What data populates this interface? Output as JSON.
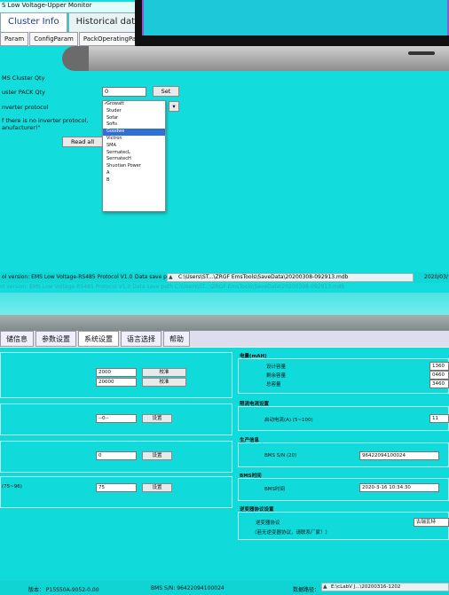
{
  "top": {
    "title": "S Low Voltage-Upper Monitor",
    "tabs": [
      "Cluster Info",
      "Historical data",
      "L"
    ],
    "subtabs": [
      "Param",
      "ConfigParam",
      "PackOperatingPara"
    ],
    "cluster_qty_label": "MS Cluster Qty",
    "pack_qty_label": "uster PACK Qty",
    "pack_qty_value": "0",
    "set_button": "Set",
    "inverter_protocol_label": "nverter protocol",
    "note_line1": "f there is no inverter protocol,",
    "note_line2": "anufacturer!\"",
    "read_all_button": "Read all",
    "protocol_options": [
      "Growatt",
      "Studer",
      "Sofar",
      "Sofis",
      "Goodwe",
      "Victron",
      "SMA",
      "SermatecL",
      "SermatecH",
      "Shuotian Power",
      "A",
      "B"
    ],
    "protocol_checked": "Growatt",
    "protocol_highlighted": "Goodwe",
    "status_version": "ol version: EMS Low Voltage-RS485 Protocol V1.0",
    "status_save_path_label": "Data save path",
    "status_save_path": "C:\\Users\\ST...\\ZRGF EmsTools\\SaveData\\20200308-092913.mdb",
    "status_date": "2020/03/",
    "ghost_text": "ol version: EMS Low Voltage-RS485 Protocol V1.0   Data save path   C:\\Users\\ST...\\ZRGF EmsTools\\SaveData\\20200308-092913.mdb"
  },
  "bottom": {
    "tabs": [
      "储信息",
      "参数设置",
      "系统设置",
      "语言选择",
      "帮助"
    ],
    "active_tab": "系统设置",
    "left": {
      "value1": "2000",
      "value2": "20000",
      "calib1": "校准",
      "calib2": "校准",
      "select_value": "--0--",
      "set1": "设置",
      "value3": "0",
      "set2": "设置",
      "range_label": "(75~96)",
      "value4": "75",
      "set3": "设置"
    },
    "right": {
      "capacity_header": "电量(mAH)",
      "design_label": "设计容量",
      "remain_label": "剩余容量",
      "full_label": "总容量",
      "design_value": "1360",
      "remain_value": "0460",
      "full_value": "3460",
      "balance_header": "限流电流设置",
      "balance_label": "启动电流(A) (5~100)",
      "balance_value": "11",
      "production_header": "生产信息",
      "sn_label": "BMS S/N (20)",
      "sn_value": "96422094100024",
      "time_header": "BMS时间",
      "time_label": "BMS时间",
      "time_value": "2020-3-16 10:34:30",
      "inverter_header": "逆变器协议设置",
      "inverter_label": "逆变器协议",
      "inverter_value": "古瑞瓦特",
      "inverter_note": "（若无逆变器协议，请联系厂家！）"
    },
    "status_version": "版本： P15S50A-9052-0.00",
    "status_sn": "BMS S/N: 96422094100024",
    "status_path_label": "数据路径：",
    "status_path": "E:\\cLabV J...\\20200316-1202"
  }
}
